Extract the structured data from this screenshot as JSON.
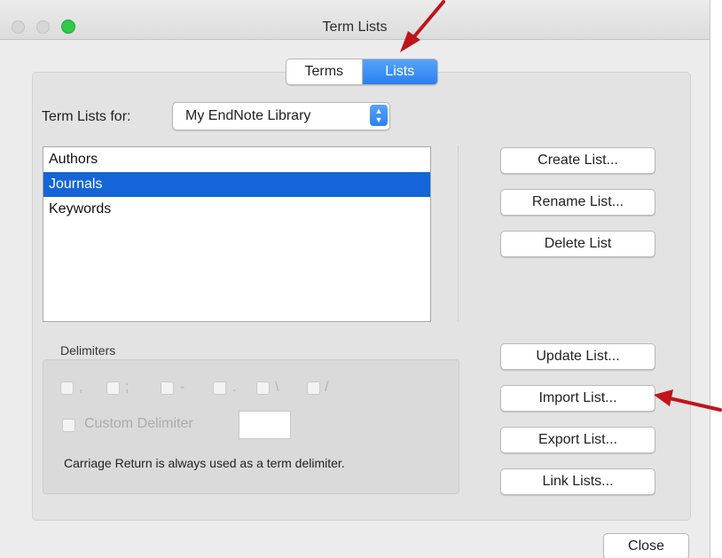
{
  "window": {
    "title": "Term Lists"
  },
  "tabs": [
    {
      "label": "Terms",
      "active": false
    },
    {
      "label": "Lists",
      "active": true
    }
  ],
  "term_lists_for": {
    "label": "Term Lists for:",
    "selected": "My EndNote Library"
  },
  "lists": {
    "items": [
      "Authors",
      "Journals",
      "Keywords"
    ],
    "selected": "Journals"
  },
  "buttons": {
    "create": "Create List...",
    "rename": "Rename List...",
    "delete": "Delete List",
    "update": "Update List...",
    "import": "Import List...",
    "export": "Export List...",
    "link": "Link Lists..."
  },
  "delimiters": {
    "title": "Delimiters",
    "options": [
      ",",
      ";",
      "-",
      ".",
      "\\",
      "/"
    ],
    "custom_label": "Custom Delimiter",
    "custom_value": "",
    "note": "Carriage Return is always used as a term delimiter."
  },
  "close_label": "Close",
  "colors": {
    "accent": "#1465d8",
    "annotation_arrow": "#c0141b"
  }
}
